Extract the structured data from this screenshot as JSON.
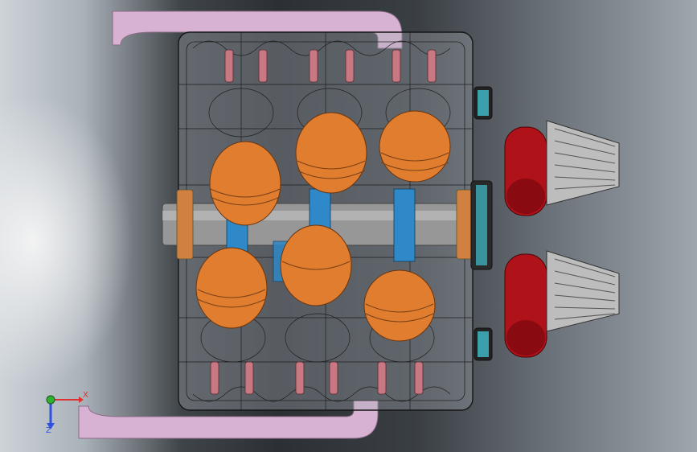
{
  "viewport": {
    "triad": {
      "x_label": "X",
      "z_label": "Z"
    }
  },
  "colors": {
    "piston": "#e07d2e",
    "conrod": "#2f88c8",
    "crankshaft": "#8f8f8f",
    "exhaust_pipe": "#d9b3d3",
    "air_filter_base": "#b0121a",
    "air_filter_cone": "#b8b8b8",
    "block_wire": "#1a1a1a",
    "valve_spring": "#c87882",
    "pulley": "#40c0d0"
  },
  "icons": [
    "coordinate-triad-icon"
  ]
}
